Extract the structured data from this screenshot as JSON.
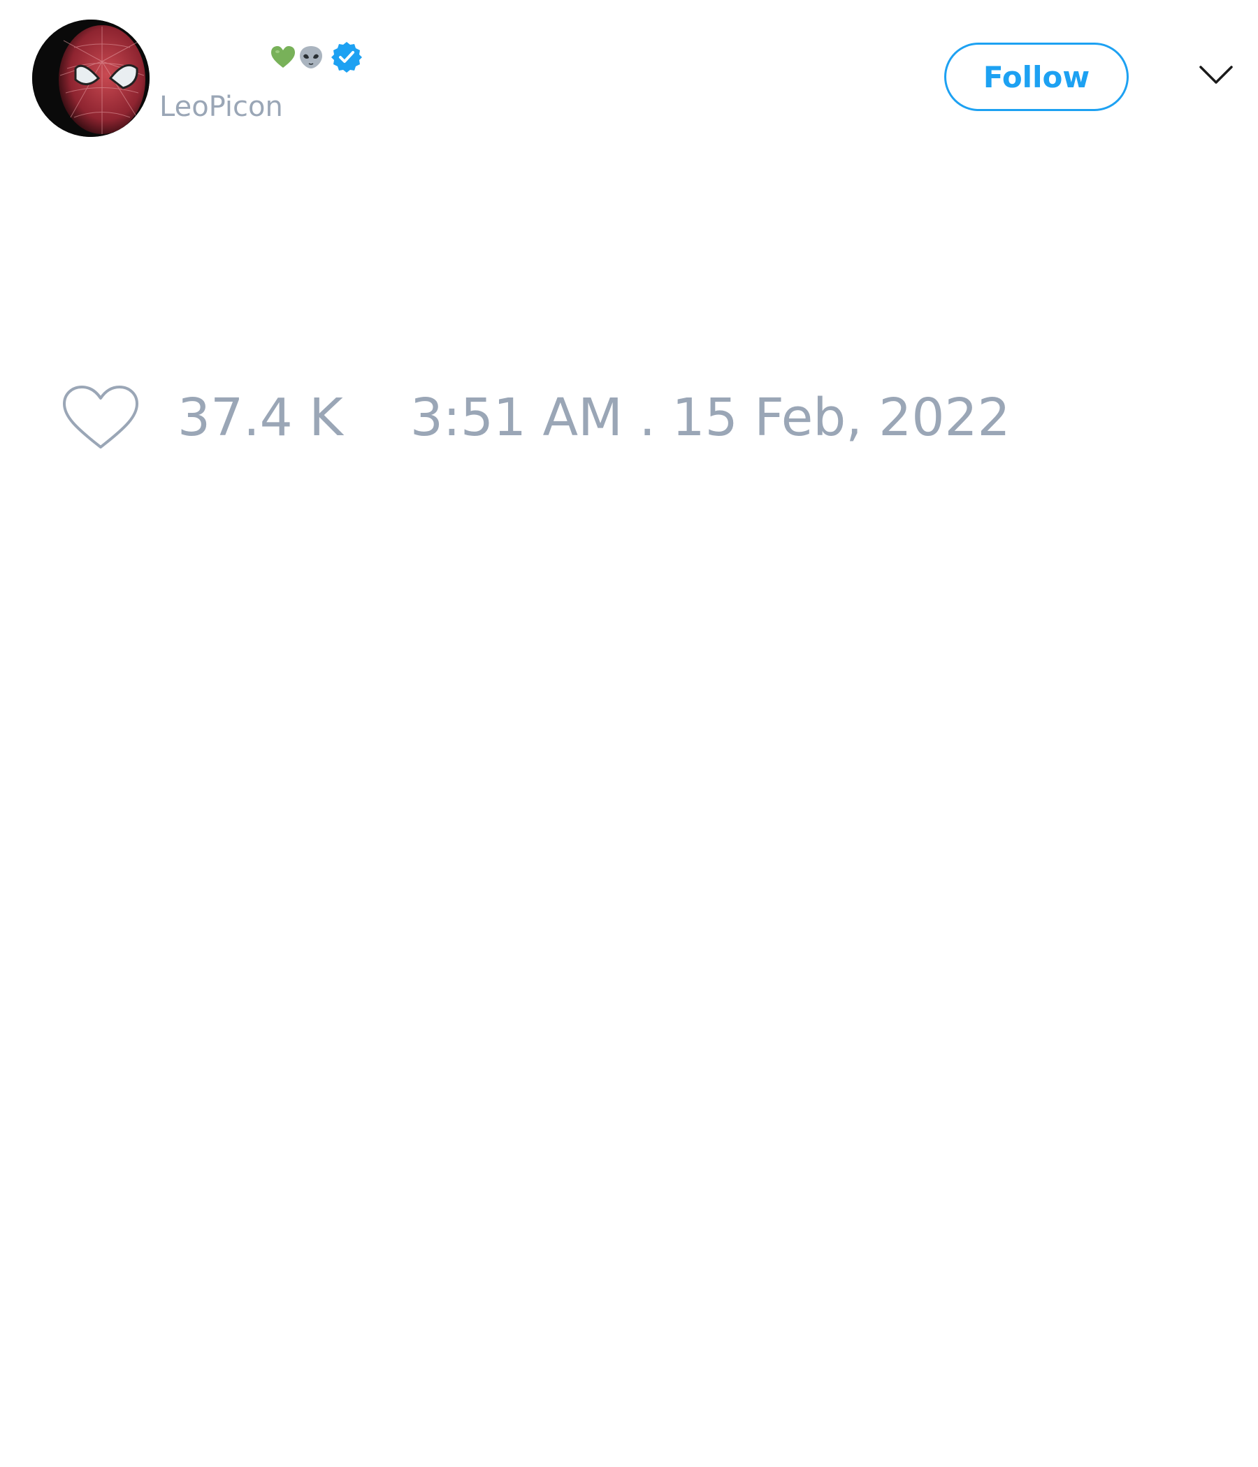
{
  "author": {
    "handle": "LeoPicon",
    "verified": true,
    "name_emojis": [
      "green-heart-icon",
      "alien-icon"
    ]
  },
  "header": {
    "follow_label": "Follow",
    "menu_icon": "chevron-down-icon"
  },
  "stats": {
    "likes": "37.4 K",
    "timestamp": "3:51 AM . 15 Feb, 2022"
  },
  "colors": {
    "accent": "#1da1f2",
    "muted_text": "#9aa6b6",
    "heart_emoji": "#78b159",
    "background": "#ffffff"
  }
}
